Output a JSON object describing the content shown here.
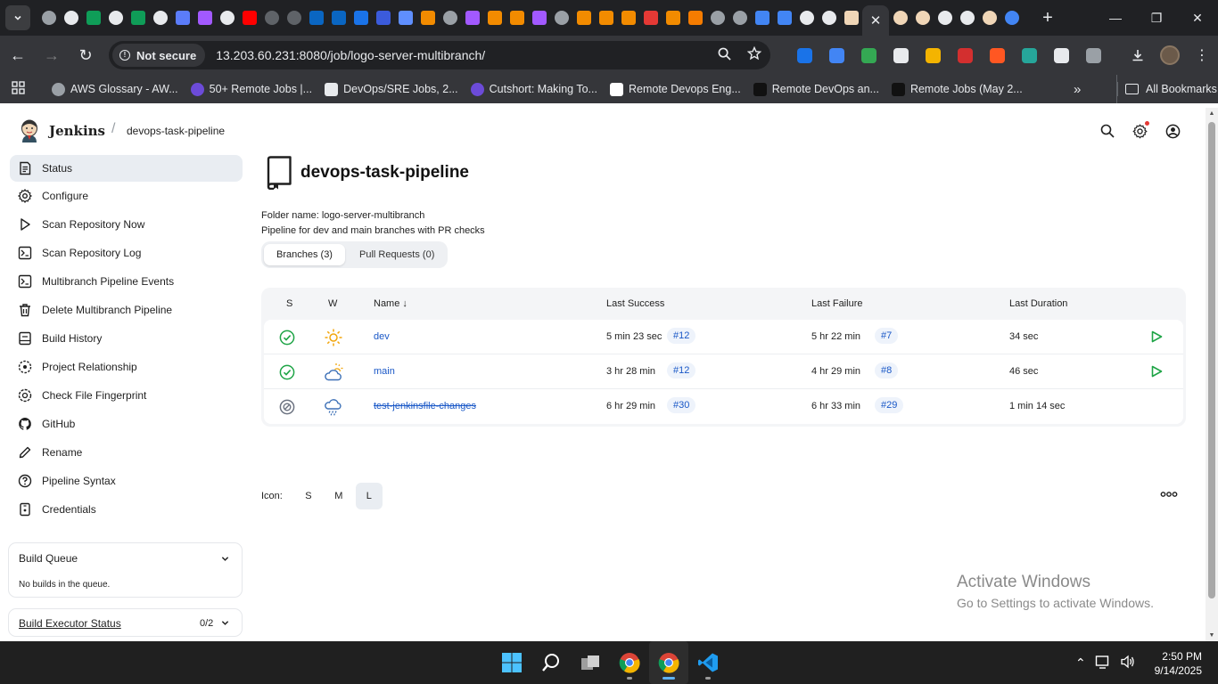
{
  "browser": {
    "url": "13.203.60.231:8080/job/logo-server-multibranch/",
    "security_label": "Not secure",
    "bookmarks": [
      {
        "label": "AWS Glossary - AW...",
        "color": "#9aa0a6"
      },
      {
        "label": "50+ Remote Jobs |...",
        "color": "#6c4bd8"
      },
      {
        "label": "DevOps/SRE Jobs, 2...",
        "color": "#e8eaed"
      },
      {
        "label": "Cutshort: Making To...",
        "color": "#6c4bd8"
      },
      {
        "label": "Remote Devops Eng...",
        "color": "#ffffff"
      },
      {
        "label": "Remote DevOps an...",
        "color": "#111111"
      },
      {
        "label": "Remote Jobs (May 2...",
        "color": "#111111"
      }
    ],
    "all_bookmarks": "All Bookmarks"
  },
  "jenkins": {
    "brand": "Jenkins",
    "breadcrumb": "devops-task-pipeline"
  },
  "sidebar": {
    "items": [
      {
        "label": "Status",
        "icon": "status-icon"
      },
      {
        "label": "Configure",
        "icon": "gear-icon"
      },
      {
        "label": "Scan Repository Now",
        "icon": "play-icon"
      },
      {
        "label": "Scan Repository Log",
        "icon": "terminal-icon"
      },
      {
        "label": "Multibranch Pipeline Events",
        "icon": "terminal-icon"
      },
      {
        "label": "Delete Multibranch Pipeline",
        "icon": "trash-icon"
      },
      {
        "label": "Build History",
        "icon": "build-history-icon"
      },
      {
        "label": "Project Relationship",
        "icon": "relationship-icon"
      },
      {
        "label": "Check File Fingerprint",
        "icon": "fingerprint-icon"
      },
      {
        "label": "GitHub",
        "icon": "github-icon"
      },
      {
        "label": "Rename",
        "icon": "pencil-icon"
      },
      {
        "label": "Pipeline Syntax",
        "icon": "help-icon"
      },
      {
        "label": "Credentials",
        "icon": "credentials-icon"
      }
    ],
    "build_queue": {
      "title": "Build Queue",
      "empty": "No builds in the queue."
    },
    "executor": {
      "title": "Build Executor Status",
      "count": "0/2"
    }
  },
  "main": {
    "title": "devops-task-pipeline",
    "folder_name": "Folder name: logo-server-multibranch",
    "description": "Pipeline for dev and main branches with PR checks",
    "tabs": [
      "Branches (3)",
      "Pull Requests (0)"
    ],
    "columns": {
      "s": "S",
      "w": "W",
      "name": "Name ↓",
      "last_success": "Last Success",
      "last_failure": "Last Failure",
      "last_duration": "Last Duration"
    },
    "rows": [
      {
        "status": "success",
        "weather": "sunny",
        "name": "dev",
        "success_time": "5 min 23 sec",
        "success_build": "#12",
        "failure_time": "5 hr 22 min",
        "failure_build": "#7",
        "duration": "34 sec",
        "disabled": false
      },
      {
        "status": "success",
        "weather": "cloudy",
        "name": "main",
        "success_time": "3 hr 28 min",
        "success_build": "#12",
        "failure_time": "4 hr 29 min",
        "failure_build": "#8",
        "duration": "46 sec",
        "disabled": false
      },
      {
        "status": "disabled",
        "weather": "rainy",
        "name": "test-jenkinsfile-changes",
        "success_time": "6 hr 29 min",
        "success_build": "#30",
        "failure_time": "6 hr 33 min",
        "failure_build": "#29",
        "duration": "1 min 14 sec",
        "disabled": true
      }
    ],
    "icon_label": "Icon:",
    "icon_sizes": [
      "S",
      "M",
      "L"
    ],
    "icon_size_selected": "L"
  },
  "overlay": {
    "activate_title": "Activate Windows",
    "activate_sub": "Go to Settings to activate Windows."
  },
  "taskbar": {
    "time": "2:50 PM",
    "date": "9/14/2025"
  },
  "colors": {
    "accent": "#1a58c7",
    "success": "#1ea446",
    "play": "#1ea446"
  }
}
